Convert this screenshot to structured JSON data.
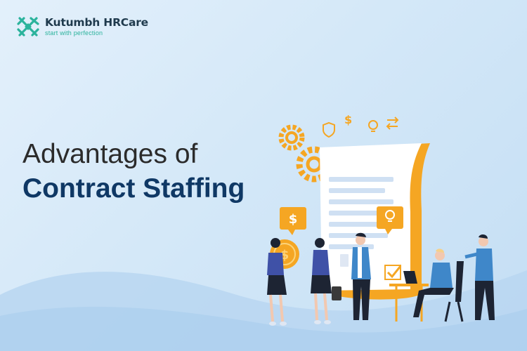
{
  "brand": {
    "name": "Kutumbh HRCare",
    "tagline": "start with perfection",
    "colors": {
      "teal": "#2bb39c",
      "navy": "#0f3865",
      "orange": "#f5a623"
    }
  },
  "headline": {
    "line1": "Advantages of",
    "line2": "Contract Staffing"
  },
  "illustration": {
    "currency_symbol": "$",
    "icons": [
      "gear-icon",
      "shield-icon",
      "dollar-icon",
      "lightbulb-icon",
      "swap-arrows-icon",
      "checkbox-icon",
      "laptop-icon"
    ]
  }
}
